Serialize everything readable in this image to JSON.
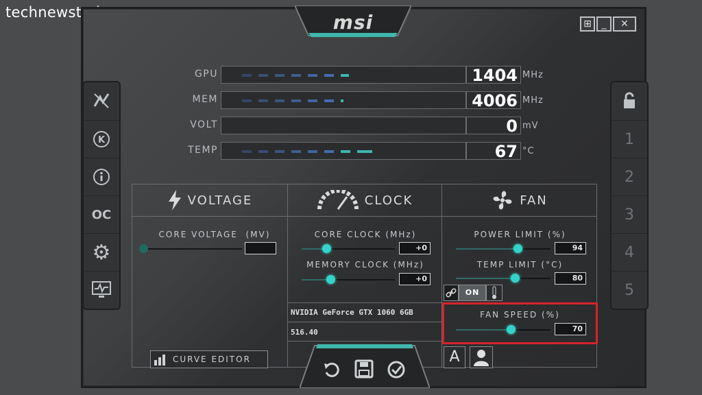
{
  "watermark": "technewstoday.com",
  "app": {
    "logo": "msi"
  },
  "window_controls": [
    {
      "name": "windows-icon",
      "glyph": "⊞"
    },
    {
      "name": "minimize-icon",
      "glyph": "_"
    },
    {
      "name": "close-icon",
      "glyph": "✕"
    }
  ],
  "left_sidebar": [
    {
      "name": "kombustor-icon",
      "glyph": "⚡"
    },
    {
      "name": "k-icon",
      "glyph": "Ⓚ"
    },
    {
      "name": "info-icon",
      "glyph": "ⓘ"
    },
    {
      "name": "oc-scanner-icon",
      "glyph": "OC"
    },
    {
      "name": "settings-gear-icon",
      "glyph": "⚙"
    },
    {
      "name": "monitor-icon",
      "glyph": "▭"
    }
  ],
  "right_sidebar": {
    "lock_icon": "lock-icon",
    "profiles": [
      "1",
      "2",
      "3",
      "4",
      "5"
    ]
  },
  "monitors": [
    {
      "label": "GPU",
      "value": "1404",
      "unit": "MHz"
    },
    {
      "label": "MEM",
      "value": "4006",
      "unit": "MHz"
    },
    {
      "label": "VOLT",
      "value": "0",
      "unit": "mV"
    },
    {
      "label": "TEMP",
      "value": "67",
      "unit": "°C"
    }
  ],
  "voltage": {
    "title": "VOLTAGE",
    "core_voltage_label": "CORE VOLTAGE",
    "core_voltage_unit": "(MV)",
    "core_voltage_value": "",
    "curve_editor_label": "CURVE EDITOR"
  },
  "clock": {
    "title": "CLOCK",
    "core_clock_label": "CORE CLOCK (MHz)",
    "core_clock_value": "+0",
    "memory_clock_label": "MEMORY CLOCK (MHz)",
    "memory_clock_value": "+0",
    "gpu_name": "NVIDIA GeForce GTX 1060 6GB",
    "driver_version": "516.40"
  },
  "fan": {
    "title": "FAN",
    "power_limit_label": "POWER LIMIT (%)",
    "power_limit_value": "94",
    "temp_limit_label": "TEMP LIMIT (°C)",
    "temp_limit_value": "80",
    "link_on_label": "ON",
    "fan_speed_label": "FAN SPEED (%)",
    "fan_speed_value": "70",
    "auto_label": "A"
  },
  "colors": {
    "accent": "#34d3c9",
    "highlight": "#d6232b",
    "monitor_bar": "#4b78c8"
  }
}
